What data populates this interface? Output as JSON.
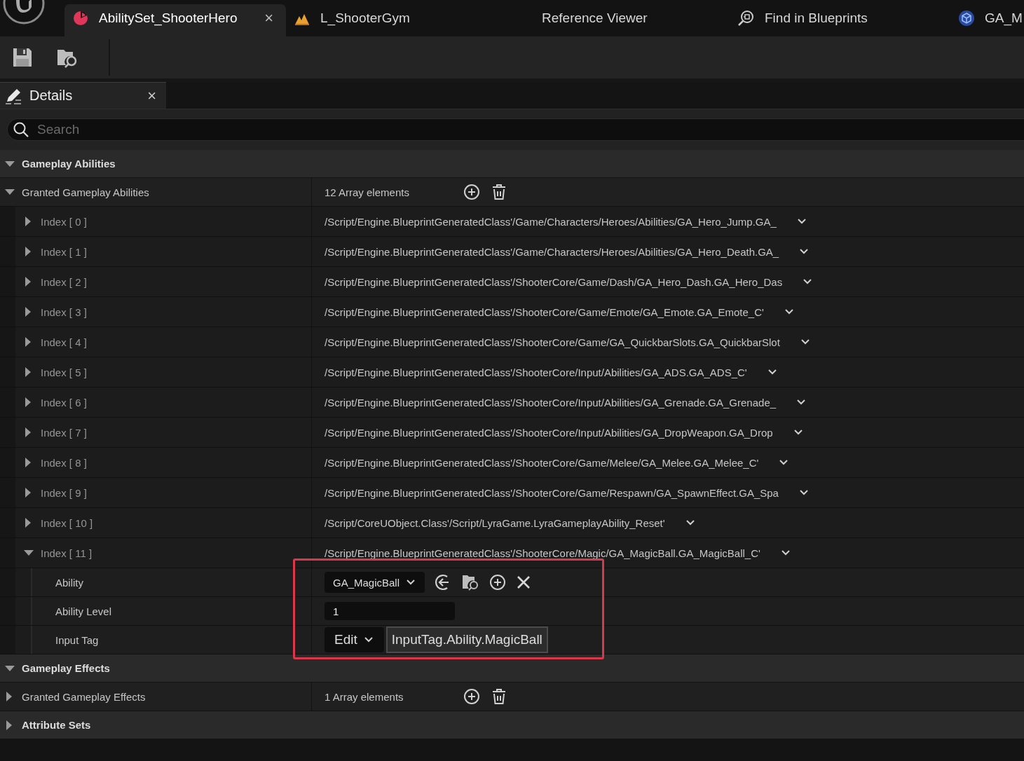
{
  "tabs": [
    {
      "label": "AbilitySet_ShooterHero",
      "kind": "asset",
      "selected": true,
      "close": "×"
    },
    {
      "label": "L_ShooterGym",
      "kind": "level",
      "selected": false
    },
    {
      "label": "Reference Viewer",
      "kind": "tool",
      "selected": false
    },
    {
      "label": "Find in Blueprints",
      "kind": "search",
      "selected": false
    },
    {
      "label": "GA_M",
      "kind": "blueprint",
      "selected": false
    }
  ],
  "details_tab": {
    "label": "Details",
    "close": "×",
    "selected": true
  },
  "search": {
    "placeholder": "Search"
  },
  "sections": [
    {
      "title": "Gameplay Abilities",
      "expanded": true,
      "properties": [
        {
          "name": "Granted Gameplay Abilities",
          "kind": "array",
          "expanded": true,
          "value": "12 Array elements",
          "elements": [
            {
              "label": "Index [ 0 ]",
              "expanded": false,
              "value": "/Script/Engine.BlueprintGeneratedClass'/Game/Characters/Heroes/Abilities/GA_Hero_Jump.GA_"
            },
            {
              "label": "Index [ 1 ]",
              "expanded": false,
              "value": "/Script/Engine.BlueprintGeneratedClass'/Game/Characters/Heroes/Abilities/GA_Hero_Death.GA_"
            },
            {
              "label": "Index [ 2 ]",
              "expanded": false,
              "value": "/Script/Engine.BlueprintGeneratedClass'/ShooterCore/Game/Dash/GA_Hero_Dash.GA_Hero_Das"
            },
            {
              "label": "Index [ 3 ]",
              "expanded": false,
              "value": "/Script/Engine.BlueprintGeneratedClass'/ShooterCore/Game/Emote/GA_Emote.GA_Emote_C'"
            },
            {
              "label": "Index [ 4 ]",
              "expanded": false,
              "value": "/Script/Engine.BlueprintGeneratedClass'/ShooterCore/Game/GA_QuickbarSlots.GA_QuickbarSlot"
            },
            {
              "label": "Index [ 5 ]",
              "expanded": false,
              "value": "/Script/Engine.BlueprintGeneratedClass'/ShooterCore/Input/Abilities/GA_ADS.GA_ADS_C'"
            },
            {
              "label": "Index [ 6 ]",
              "expanded": false,
              "value": "/Script/Engine.BlueprintGeneratedClass'/ShooterCore/Input/Abilities/GA_Grenade.GA_Grenade_"
            },
            {
              "label": "Index [ 7 ]",
              "expanded": false,
              "value": "/Script/Engine.BlueprintGeneratedClass'/ShooterCore/Input/Abilities/GA_DropWeapon.GA_Drop"
            },
            {
              "label": "Index [ 8 ]",
              "expanded": false,
              "value": "/Script/Engine.BlueprintGeneratedClass'/ShooterCore/Game/Melee/GA_Melee.GA_Melee_C'"
            },
            {
              "label": "Index [ 9 ]",
              "expanded": false,
              "value": "/Script/Engine.BlueprintGeneratedClass'/ShooterCore/Game/Respawn/GA_SpawnEffect.GA_Spa"
            },
            {
              "label": "Index [ 10 ]",
              "expanded": false,
              "value": "/Script/CoreUObject.Class'/Script/LyraGame.LyraGameplayAbility_Reset'"
            },
            {
              "label": "Index [ 11 ]",
              "expanded": true,
              "value": "/Script/Engine.BlueprintGeneratedClass'/ShooterCore/Magic/GA_MagicBall.GA_MagicBall_C'",
              "children": [
                {
                  "name": "Ability",
                  "kind": "class",
                  "value": "GA_MagicBall"
                },
                {
                  "name": "Ability Level",
                  "kind": "number",
                  "value": "1"
                },
                {
                  "name": "Input Tag",
                  "kind": "tag",
                  "button": "Edit",
                  "value": "InputTag.Ability.MagicBall"
                }
              ]
            }
          ]
        }
      ]
    },
    {
      "title": "Gameplay Effects",
      "expanded": true,
      "properties": [
        {
          "name": "Granted Gameplay Effects",
          "kind": "array",
          "expanded": false,
          "value": "1 Array elements"
        }
      ]
    },
    {
      "title": "Attribute Sets",
      "expanded": false
    }
  ]
}
